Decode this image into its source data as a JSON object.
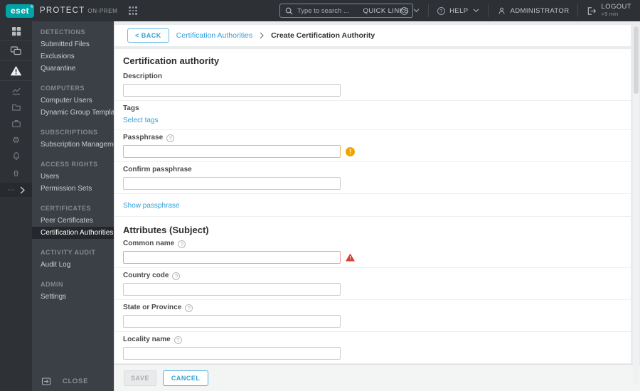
{
  "topbar": {
    "logo": "eset",
    "product": "PROTECT",
    "edition": "ON-PREM",
    "search_placeholder": "Type to search ...",
    "quick_links": "QUICK LINKS",
    "help": "HELP",
    "user": "ADMINISTRATOR",
    "logout": "LOGOUT",
    "session": ">9 min"
  },
  "sidebar": {
    "more": "⋯",
    "close": "CLOSE",
    "sections": [
      {
        "header": "DETECTIONS",
        "items": [
          "Submitted Files",
          "Exclusions",
          "Quarantine"
        ]
      },
      {
        "header": "COMPUTERS",
        "items": [
          "Computer Users",
          "Dynamic Group Templates"
        ]
      },
      {
        "header": "SUBSCRIPTIONS",
        "items": [
          "Subscription Management"
        ]
      },
      {
        "header": "ACCESS RIGHTS",
        "items": [
          "Users",
          "Permission Sets"
        ]
      },
      {
        "header": "CERTIFICATES",
        "items": [
          "Peer Certificates",
          "Certification Authorities"
        ]
      },
      {
        "header": "ACTIVITY AUDIT",
        "items": [
          "Audit Log"
        ]
      },
      {
        "header": "ADMIN",
        "items": [
          "Settings"
        ]
      }
    ],
    "active_item": "Certification Authorities"
  },
  "breadcrumb": {
    "back": "< BACK",
    "parent": "Certification Authorities",
    "current": "Create Certification Authority"
  },
  "form": {
    "title": "Certification authority",
    "description_label": "Description",
    "description_value": "",
    "tags_label": "Tags",
    "select_tags_link": "Select tags",
    "passphrase_label": "Passphrase",
    "passphrase_value": "",
    "confirm_passphrase_label": "Confirm passphrase",
    "confirm_passphrase_value": "",
    "show_passphrase_link": "Show passphrase",
    "attributes_title": "Attributes (Subject)",
    "common_name_label": "Common name",
    "common_name_value": "",
    "country_code_label": "Country code",
    "country_code_value": "",
    "state_label": "State or Province",
    "state_value": "",
    "locality_label": "Locality name",
    "locality_value": ""
  },
  "footer": {
    "save": "SAVE",
    "cancel": "CANCEL"
  },
  "icons": {
    "help": "?",
    "warning": "!",
    "gear": "⚙"
  },
  "colors": {
    "accent_blue": "#2f9fd8",
    "warning_orange": "#f0a400",
    "error_red": "#cf4130",
    "brand_teal": "#00a3a6",
    "topbar_bg": "#2d3136",
    "menu_bg": "#3b4046",
    "active_item_bg": "#24272b"
  }
}
